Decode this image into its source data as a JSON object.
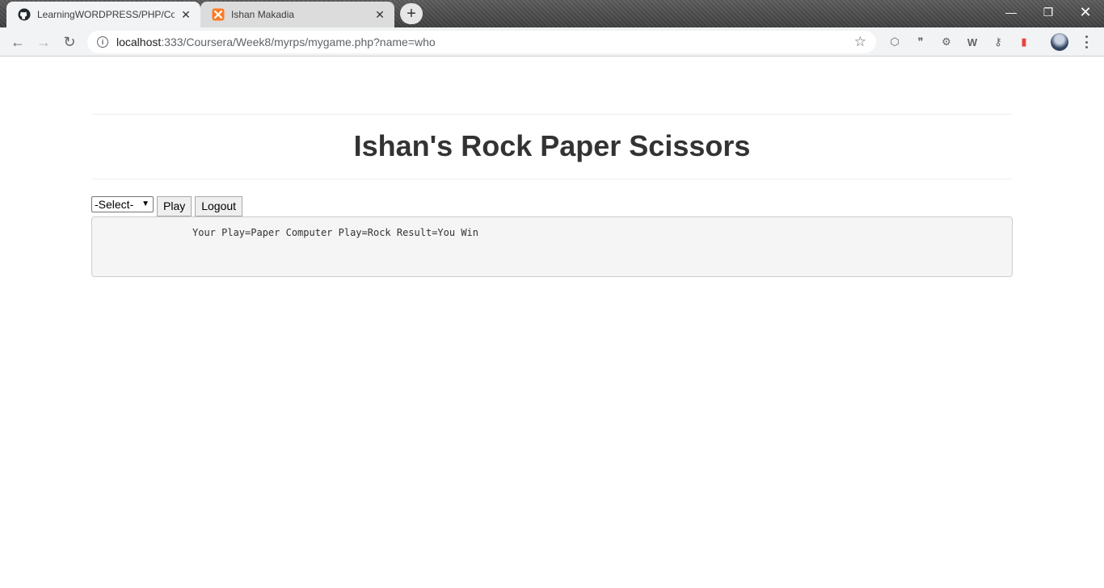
{
  "browser": {
    "tabs": [
      {
        "title": "LearningWORDPRESS/PHP/Cours",
        "favicon": "github-icon",
        "active": true
      },
      {
        "title": "Ishan Makadia",
        "favicon": "xampp-icon",
        "active": false
      }
    ],
    "address": {
      "host": "localhost",
      "path": ":333/Coursera/Week8/myrps/mygame.php?name=who"
    }
  },
  "page": {
    "heading": "Ishan's Rock Paper Scissors",
    "select": {
      "selected": "-Select-"
    },
    "play_label": "Play",
    "logout_label": "Logout",
    "result_text": "Your Play=Paper Computer Play=Rock Result=You Win"
  },
  "colors": {
    "heading": "#333333",
    "result_bg": "#f5f5f5",
    "result_border": "#cccccc",
    "xampp_orange": "#fb7a24"
  }
}
